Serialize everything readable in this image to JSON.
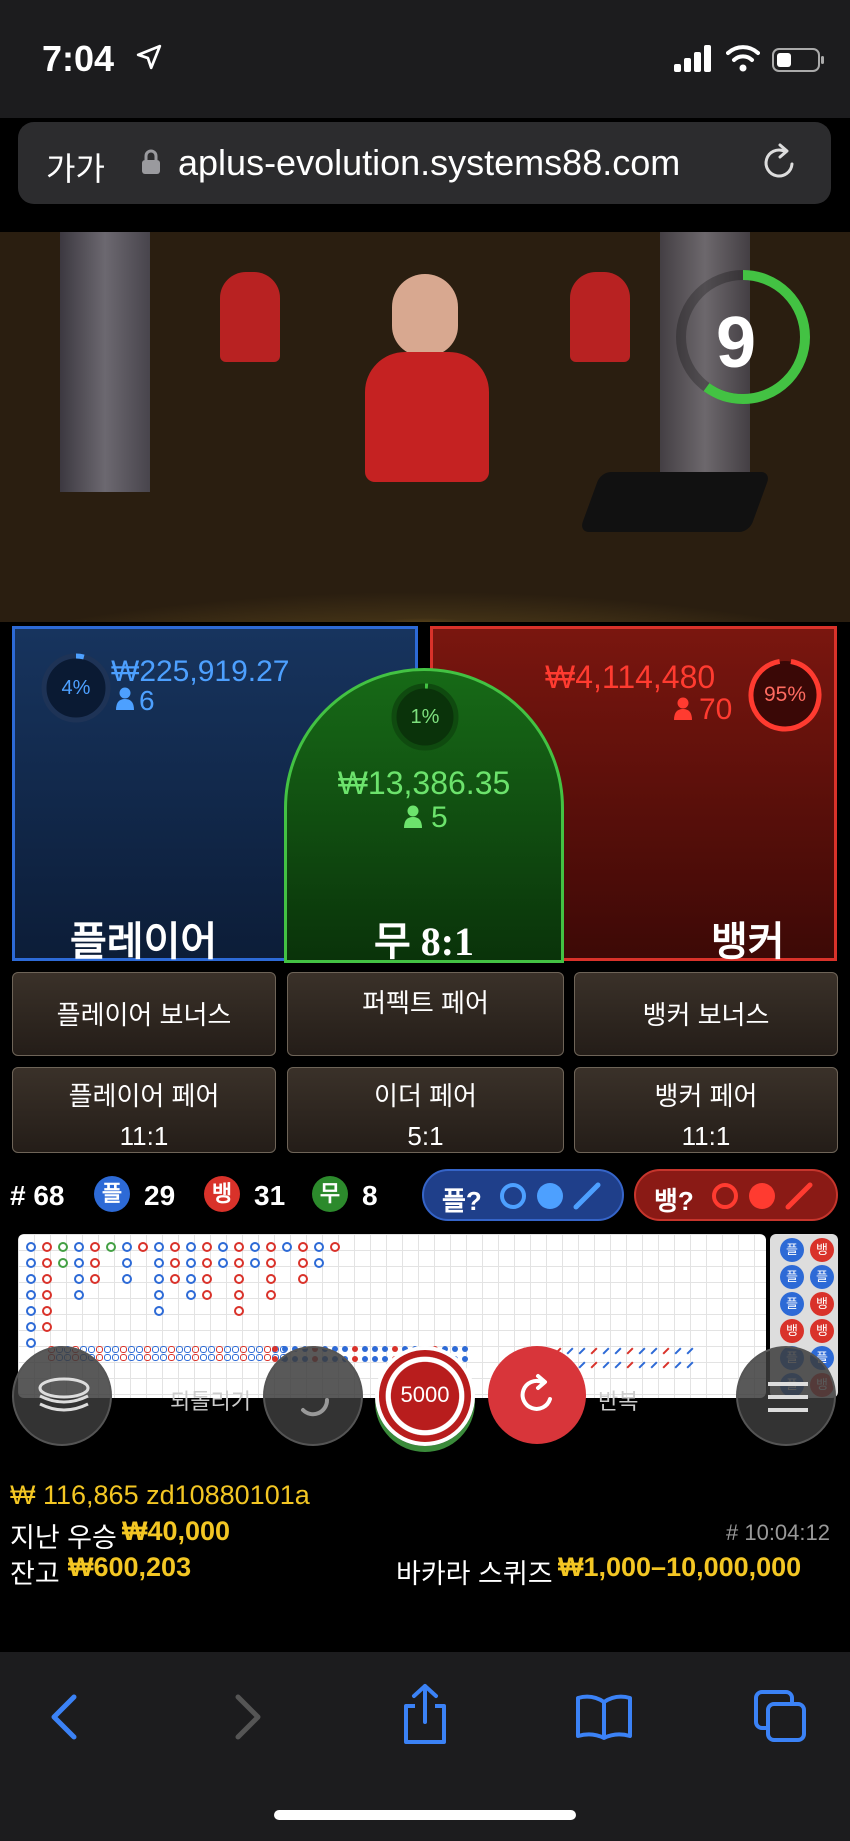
{
  "status_bar": {
    "time": "7:04"
  },
  "browser": {
    "text_size_label": "가가",
    "url": "aplus-evolution.systems88.com"
  },
  "timer": {
    "seconds": "9",
    "progress": 0.6
  },
  "player": {
    "label": "플레이어",
    "percent": "4%",
    "amount": "₩225,919.27",
    "players": "6"
  },
  "tie": {
    "label": "무 8:1",
    "percent": "1%",
    "amount": "₩13,386.35",
    "players": "5"
  },
  "banker": {
    "label": "뱅커",
    "percent": "95%",
    "amount": "₩4,114,480",
    "players": "70"
  },
  "side_bets": {
    "player_bonus": "플레이어 보너스",
    "perfect_pair": "퍼펙트 페어",
    "banker_bonus": "뱅커 보너스",
    "player_pair": "플레이어 페어",
    "player_pair_odds": "11:1",
    "either_pair": "이더 페어",
    "either_pair_odds": "5:1",
    "banker_pair": "뱅커 페어",
    "banker_pair_odds": "11:1"
  },
  "stats": {
    "round_label": "# 68",
    "player_badge": "플",
    "player_count": "29",
    "banker_badge": "뱅",
    "banker_count": "31",
    "tie_badge": "무",
    "tie_count": "8",
    "player_predict_label": "플?",
    "banker_predict_label": "뱅?"
  },
  "bead_road": [
    "플",
    "플",
    "플",
    "뱅",
    "플",
    "플",
    "뱅",
    "플",
    "뱅",
    "뱅",
    "플",
    "뱅"
  ],
  "controls": {
    "undo_label": "되돌리기",
    "chip_value": "5000",
    "repeat_label": "반복"
  },
  "info": {
    "balance_line": "₩ 116,865 zd10880101a",
    "last_win_label": "지난 우승",
    "last_win_amount": "₩40,000",
    "round_id": "# 10:04:12",
    "balance_label": "잔고",
    "balance_amount": "₩600,203",
    "table_name": "바카라 스퀴즈",
    "bet_limits": "₩1,000–10,000,000"
  },
  "colors": {
    "player": "#2d6ad6",
    "banker": "#d9322a",
    "tie": "#43c243",
    "accent": "#f3c623"
  }
}
